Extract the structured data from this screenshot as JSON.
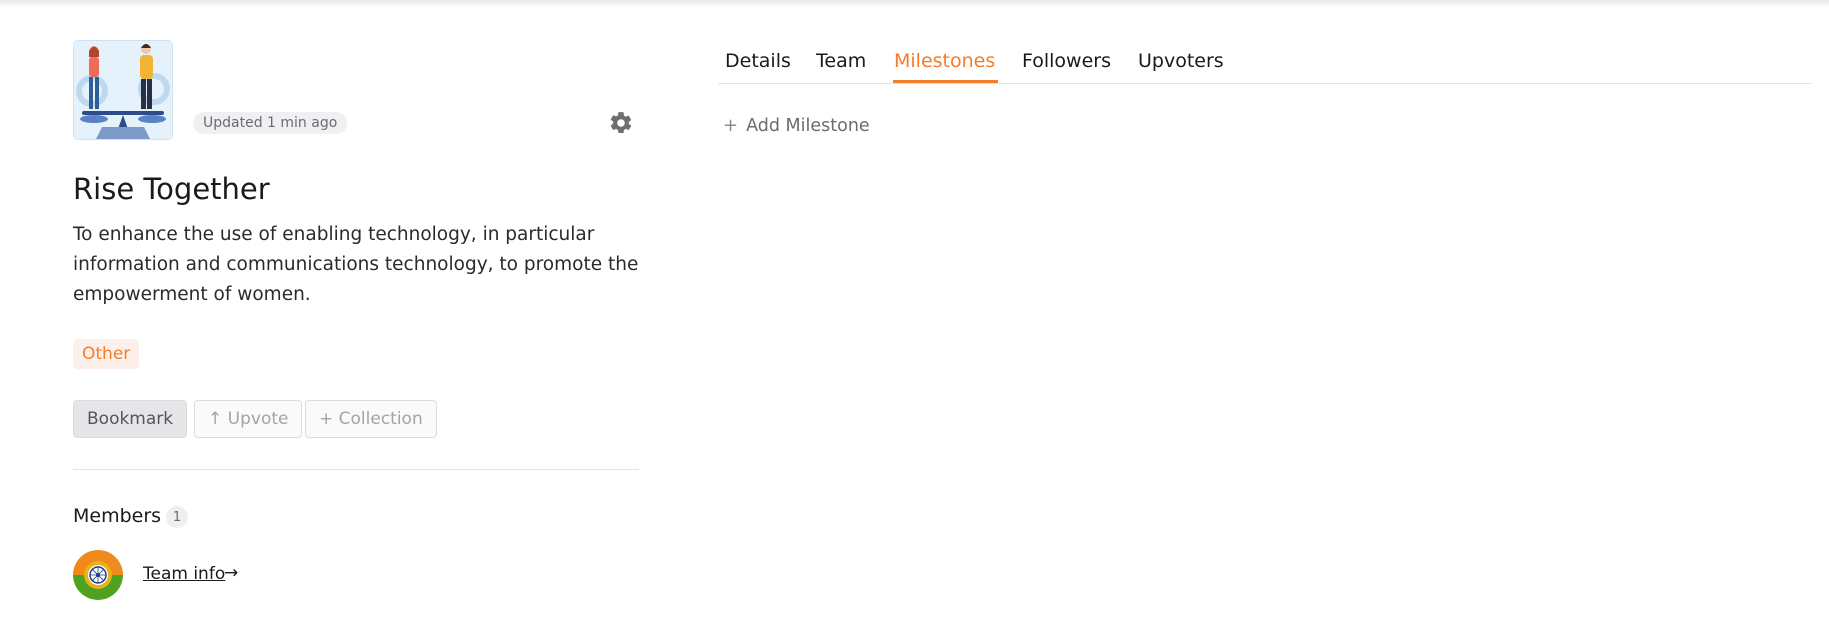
{
  "project": {
    "updated": "Updated 1 min ago",
    "title": "Rise Together",
    "description": "To enhance the use of enabling technology, in particular information and communications technology, to promote the empowerment of women.",
    "tag": "Other",
    "accent_color": "#f57c28"
  },
  "actions": {
    "bookmark": "Bookmark",
    "upvote": "↑ Upvote",
    "collection": "+ Collection"
  },
  "members": {
    "label": "Members",
    "count": "1",
    "team_link": "Team info",
    "arrow": "→"
  },
  "tabs": [
    {
      "label": "Details"
    },
    {
      "label": "Team"
    },
    {
      "label": "Milestones",
      "active": true
    },
    {
      "label": "Followers"
    },
    {
      "label": "Upvoters"
    }
  ],
  "milestones": {
    "add_label": "Add Milestone",
    "add_icon": "plus-icon"
  },
  "icons": {
    "settings": "gear-icon",
    "avatar": "team-avatar"
  }
}
